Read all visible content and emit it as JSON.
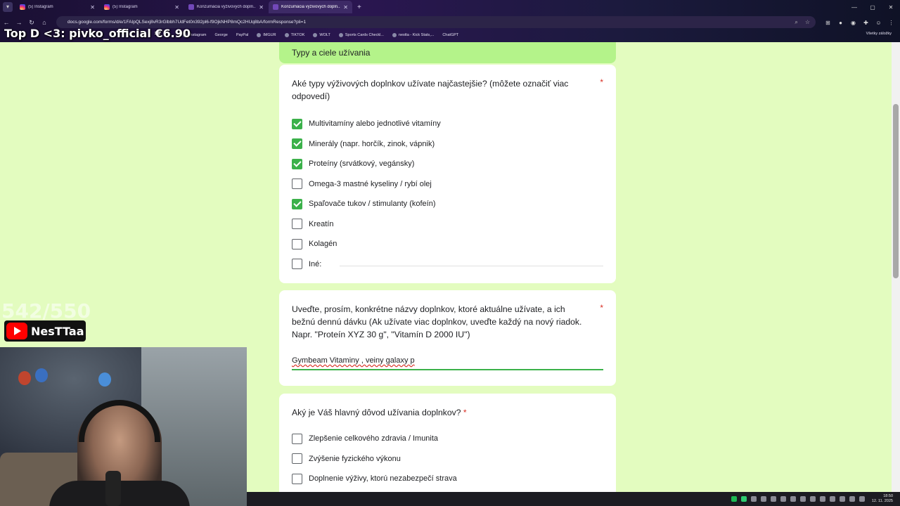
{
  "browser": {
    "tabs": [
      {
        "label": "(5) Instagram",
        "favicon": "instagram-icon",
        "active": false
      },
      {
        "label": "(5) Instagram",
        "favicon": "instagram-icon",
        "active": false
      },
      {
        "label": "Konzumácia výživových dopln...",
        "favicon": "forms-icon",
        "active": false
      },
      {
        "label": "Konzumácia výživových dopln...",
        "favicon": "forms-icon",
        "active": true
      }
    ],
    "url": "docs.google.com/forms/d/e/1FAIpQLSexj8vR3rGlbbh7UdFet0n392pl6-f9OjkNHP8mQc2HUq8bA/formResponse?pli=1",
    "bookmarks": [
      "Instagram",
      "George",
      "PayPal",
      "IMGUR",
      "TIKTOK",
      "WOLT",
      "Sports Cards Checkl...",
      "nestta - Kick Stats,...",
      "ChatGPT"
    ],
    "all_bookmarks": "Všetky záložky"
  },
  "stream": {
    "top_overlay": "Top D <3: pivko_official €6.90",
    "counter": "542/550",
    "channel": "NesTTaa"
  },
  "form": {
    "section_title": "Typy a ciele užívania",
    "q1": {
      "title": "Aké typy výživových doplnkov užívate najčastejšie? (môžete označiť viac odpovedí)",
      "required_mark": "*",
      "options": [
        {
          "label": "Multivitamíny alebo jednotlivé vitamíny",
          "checked": true
        },
        {
          "label": "Minerály (napr. horčík, zinok, vápnik)",
          "checked": true
        },
        {
          "label": "Proteíny (srvátkový, vegánsky)",
          "checked": true
        },
        {
          "label": "Omega-3 mastné kyseliny / rybí olej",
          "checked": false
        },
        {
          "label": "Spaľovače tukov / stimulanty (kofeín)",
          "checked": true
        },
        {
          "label": "Kreatín",
          "checked": false
        },
        {
          "label": "Kolagén",
          "checked": false
        },
        {
          "label": "Iné:",
          "checked": false
        }
      ]
    },
    "q2": {
      "title": "Uveďte, prosím, konkrétne názvy doplnkov, ktoré aktuálne užívate, a ich bežnú dennú dávku (Ak užívate viac doplnkov, uveďte každý na nový riadok. Napr. \"Proteín XYZ 30 g\", \"Vitamín D 2000 IU\")",
      "required_mark": "*",
      "answer": "Gymbeam Vitaminy , veiny galaxy p"
    },
    "q3": {
      "title": "Aký je Váš hlavný dôvod užívania doplnkov?",
      "required_mark": "*",
      "options": [
        {
          "label": "Zlepšenie celkového zdravia / Imunita",
          "checked": false
        },
        {
          "label": "Zvýšenie fyzického výkonu",
          "checked": false
        },
        {
          "label": "Doplnenie výživy, ktorú nezabezpečí strava",
          "checked": false
        }
      ]
    }
  },
  "taskbar": {
    "time": "18:50",
    "date": "12. 11. 2025"
  },
  "colors": {
    "page_bg": "#e3fcbf",
    "section_header": "#b4f38a",
    "checkbox_checked": "#3bb14a",
    "required": "#d93025"
  }
}
